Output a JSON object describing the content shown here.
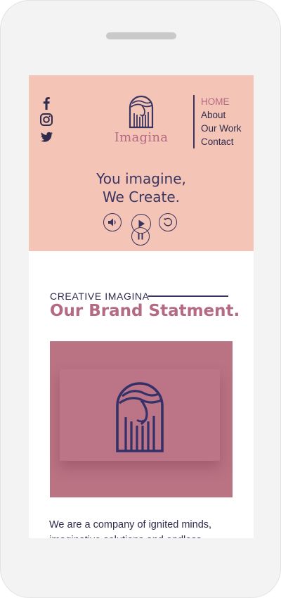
{
  "colors": {
    "hero_bg": "#f4c4b6",
    "accent": "#b56a83",
    "navy": "#3a3560",
    "image_bg": "#b97383"
  },
  "social": [
    "facebook-icon",
    "instagram-icon",
    "twitter-icon"
  ],
  "brand": {
    "name": "Imagina"
  },
  "nav": {
    "items": [
      "HOME",
      "About",
      "Our Work",
      "Contact"
    ],
    "active": "HOME"
  },
  "hero": {
    "line1": "You imagine,",
    "line2": "We Create."
  },
  "controls": [
    "volume-icon",
    "play-icon",
    "replay-icon",
    "pause-icon"
  ],
  "section": {
    "eyebrow": "CREATIVE IMAGINA",
    "title": "Our Brand Statment."
  },
  "body": {
    "text": "We are a company of ignited minds, imaginative solutions and endless"
  }
}
